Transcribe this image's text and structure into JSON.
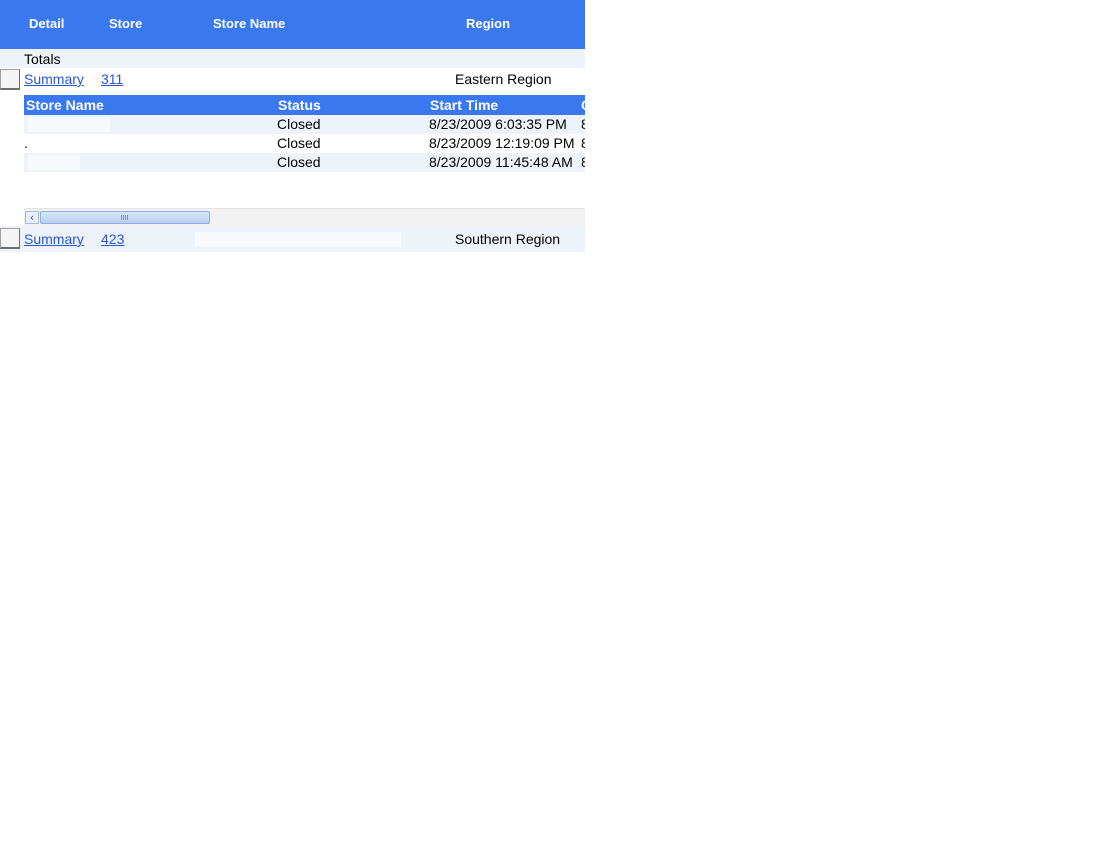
{
  "header": {
    "columns": [
      "Detail",
      "Store",
      "Store Name",
      "Region"
    ]
  },
  "totals": {
    "label": "Totals"
  },
  "rows": [
    {
      "summary_label": "Summary",
      "store": "311",
      "store_name": "",
      "region": "Eastern Region",
      "detail": {
        "columns": [
          "Store Name",
          "Status",
          "Start Time"
        ],
        "rows": [
          {
            "store_name": "",
            "status": "Closed",
            "start_time": "8/23/2009 6:03:35 PM",
            "extra": "8"
          },
          {
            "store_name": ".",
            "status": "Closed",
            "start_time": "8/23/2009 12:19:09 PM",
            "extra": "8"
          },
          {
            "store_name": "",
            "status": "Closed",
            "start_time": "8/23/2009 11:45:48 AM",
            "extra": "8"
          }
        ],
        "next_col_partial": "C"
      }
    },
    {
      "summary_label": "Summary",
      "store": "423",
      "store_name": "",
      "region": "Southern Region"
    }
  ],
  "scrollbar": {
    "left_arrow_icon": "chevron-left-icon",
    "position": 0.0
  },
  "colors": {
    "header_bg": "#3a78f0",
    "row_tint": "#eef2f9",
    "link": "#2a55d6"
  }
}
